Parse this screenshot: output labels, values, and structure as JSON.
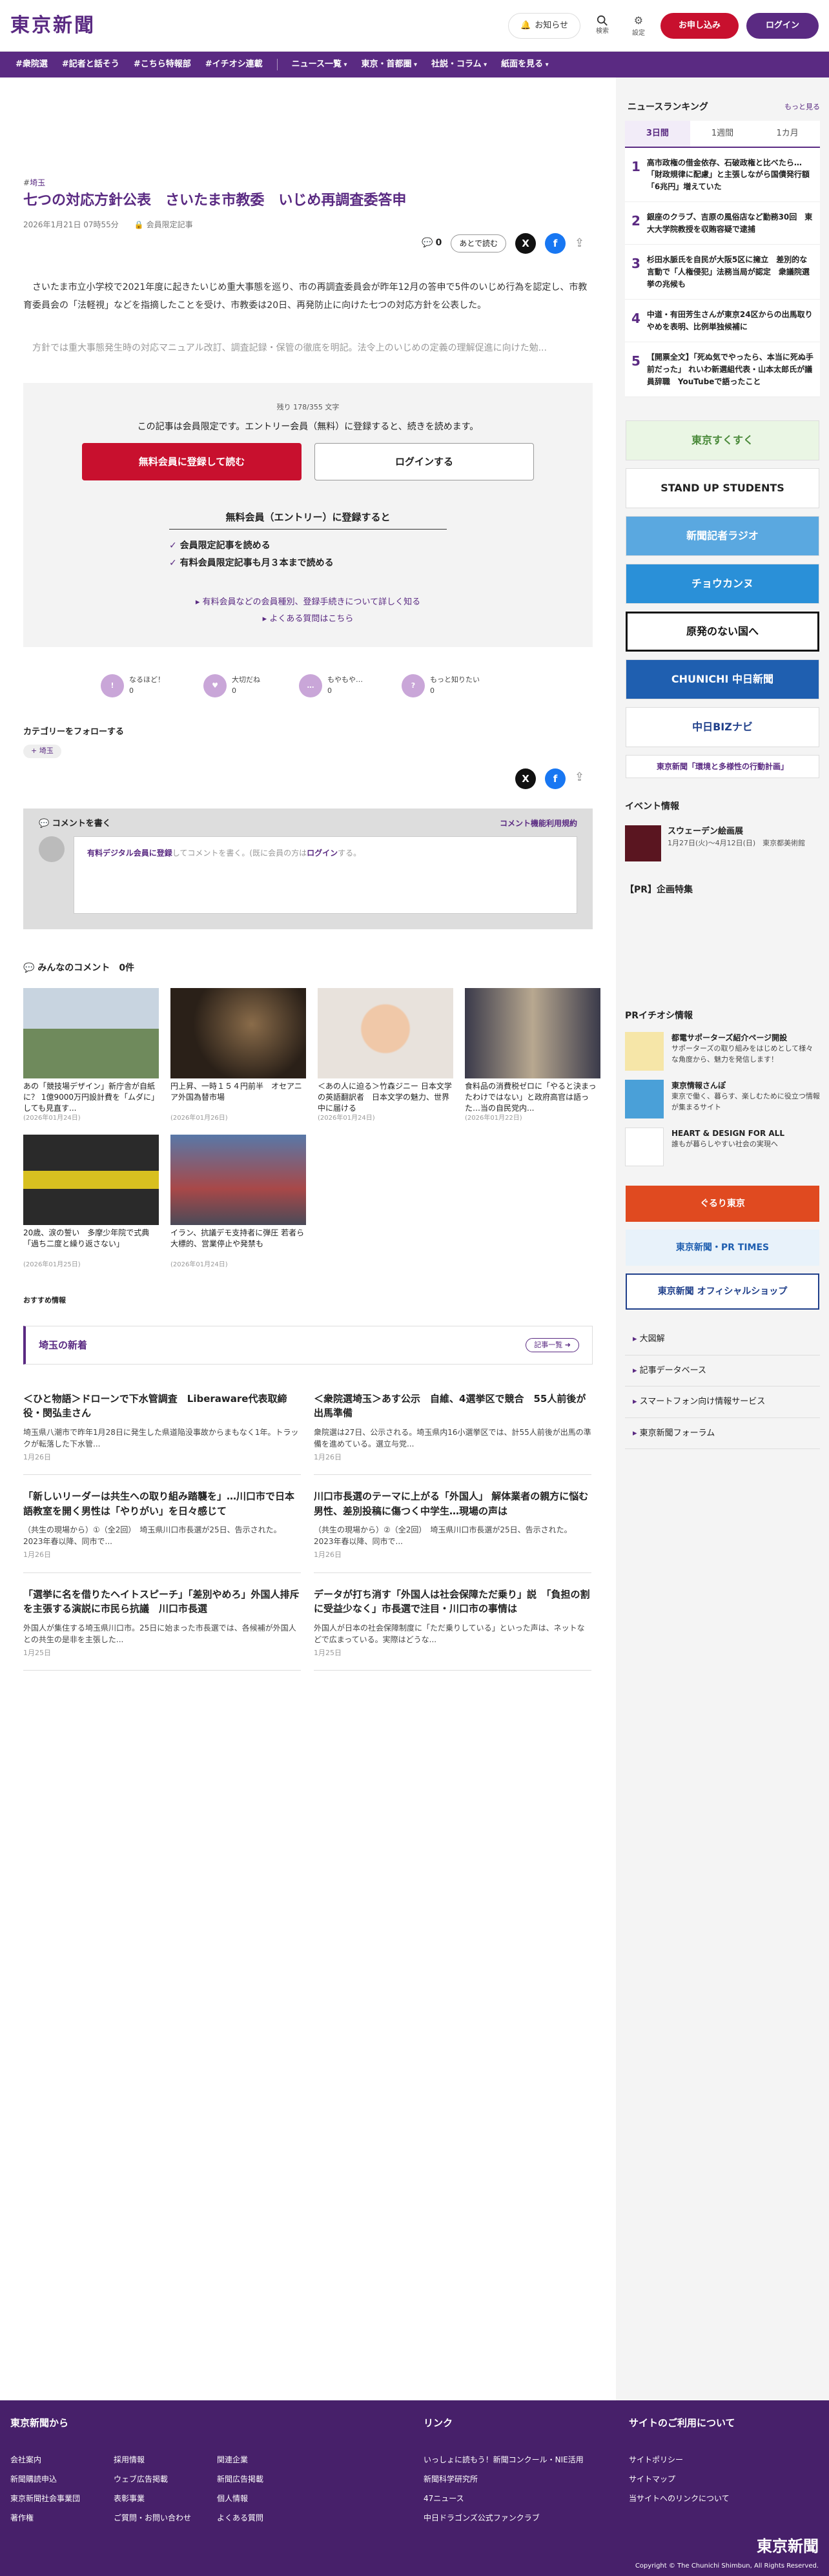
{
  "header": {
    "logo": "東京新聞",
    "notice": "お知らせ",
    "search": "検索",
    "settings": "設定",
    "register": "お申し込み",
    "login": "ログイン"
  },
  "nav": [
    "#衆院選",
    "#記者と話そう",
    "#こちら特報部",
    "#イチオシ連載",
    "ニュース一覧",
    "東京・首都圏",
    "社説・コラム",
    "紙面を見る"
  ],
  "article": {
    "tag": "埼玉",
    "title": "七つの対応方針公表　さいたま市教委　いじめ再調査委答申",
    "date": "2026年1月21日 07時55分",
    "members": "会員限定記事",
    "comment_count": "0",
    "later": "あとで読む",
    "p1": "さいたま市立小学校で2021年度に起きたいじめ重大事態を巡り、市の再調査委員会が昨年12月の答申で5件のいじめ行為を認定し、市教育委員会の「法軽視」などを指摘したことを受け、市教委は20日、再発防止に向けた七つの対応方針を公表した。",
    "p2": "方針では重大事態発生時の対応マニュアル改訂、調査記録・保管の徹底を明記。法令上のいじめの定義の理解促進に向けた勉..."
  },
  "paywall": {
    "remain": "残り 178/355 文字",
    "line": "この記事は会員限定です。エントリー会員（無料）に登録すると、続きを読めます。",
    "register": "無料会員に登録して読む",
    "login": "ログインする",
    "benefit_title": "無料会員（エントリー）に登録すると",
    "benefits": [
      "会員限定記事を読める",
      "有料会員限定記事も月３本まで読める"
    ],
    "link1": "有料会員などの会員種別、登録手続きについて詳しく知る",
    "link2": "よくある質問はこちら"
  },
  "reactions": [
    {
      "label": "なるほど！",
      "count": "0"
    },
    {
      "label": "大切だね",
      "count": "0"
    },
    {
      "label": "もやもや…",
      "count": "0"
    },
    {
      "label": "もっと知りたい",
      "count": "0"
    }
  ],
  "category": {
    "title": "カテゴリーをフォローする",
    "chip": "埼玉"
  },
  "comment": {
    "heading": "コメントを書く",
    "rules": "コメント機能利用規約",
    "placeholder_link": "有料デジタル会員に登録",
    "placeholder_rest": "してコメントを書く。(既に会員の方は",
    "placeholder_login": "ログイン",
    "placeholder_end": "する。",
    "all": "みんなのコメント",
    "all_count": "0件"
  },
  "photos": [
    {
      "title": "あの「競技場デザイン」新庁舎が自紙に？ 1億9000万円設計費を「ムダに」しても見直す...",
      "date": "(2026年01月24日)"
    },
    {
      "title": "円上昇、一時１５４円前半　オセアニア外国為替市場",
      "date": "(2026年01月26日)"
    },
    {
      "title": "＜あの人に迫る＞竹森ジニー 日本文学の英語翻訳者　日本文学の魅力、世界中に届ける",
      "date": "(2026年01月24日)"
    },
    {
      "title": "食料品の消費税ゼロに「やると決まったわけではない」と政府高官は語った…当の自民党内...",
      "date": "(2026年01月22日)"
    },
    {
      "title": "20歳、涙の誓い　多摩少年院で式典「過ち二度と繰り返さない」",
      "date": "(2026年01月25日)"
    },
    {
      "title": "イラン、抗議デモ支持者に弾圧 若者ら大標的、営業停止や発禁も",
      "date": "(2026年01月24日)"
    }
  ],
  "recommend": "おすすめ情報",
  "news_block": {
    "title": "埼玉の新着",
    "more": "記事一覧",
    "items": [
      {
        "title": "＜ひと物語＞ドローンで下水管調査　Liberaware代表取締役・閔弘圭さん",
        "body": "埼玉県八潮市で昨年1月28日に発生した県道陥没事故からまもなく1年。トラックが転落した下水管...",
        "date": "1月26日"
      },
      {
        "title": "＜衆院選埼玉＞あす公示　自維、4選挙区で競合　55人前後が出馬準備",
        "body": "衆院選は27日、公示される。埼玉県内16小選挙区では、計55人前後が出馬の準備を進めている。選立与党...",
        "date": "1月26日"
      },
      {
        "title": "「新しいリーダーは共生への取り組み踏襲を」…川口市で日本語教室を開く男性は「やりがい」を日々感じて",
        "body": "（共生の現場から）①（全2回）　埼玉県川口市長選が25日、告示された。2023年春以降、同市で...",
        "date": "1月26日"
      },
      {
        "title": "川口市長選のテーマに上がる「外国人」 解体業者の親方に悩む男性、差別投稿に傷つく中学生…現場の声は",
        "body": "（共生の現場から）②（全2回）　埼玉県川口市長選が25日、告示された。2023年春以降、同市で...",
        "date": "1月26日"
      },
      {
        "title": "「選挙に名を借りたヘイトスピーチ」「差別やめろ」外国人排斥を主張する演説に市民ら抗議　川口市長選",
        "body": "外国人が集住する埼玉県川口市。25日に始まった市長選では、各候補が外国人との共生の是非を主張した...",
        "date": "1月25日"
      },
      {
        "title": "データが打ち消す「外国人は社会保障ただ乗り」説　「負担の割に受益少なく」市長選で注目・川口市の事情は",
        "body": "外国人が日本の社会保障制度に「ただ乗りしている」といった声は、ネットなどで広まっている。実際はどうな...",
        "date": "1月25日"
      }
    ]
  },
  "ranking": {
    "title": "ニュースランキング",
    "more": "もっと見る",
    "tabs": [
      "3日間",
      "1週間",
      "1カ月"
    ],
    "items": [
      "高市政権の借金依存、石破政権と比べたら…「財政規律に配慮」と主張しながら国債発行額「6兆円」増えていた",
      "銀座のクラブ、吉原の風俗店など勤務30回　東大大学院教授を収賄容疑で逮捕",
      "杉田水脈氏を自民が大阪5区に擁立　差別的な言動で「人権侵犯」法務当局が認定　衆議院選挙の兆候も",
      "中道・有田芳生さんが東京24区からの出馬取りやめを表明、比例単独候補に",
      "【開票全文】「死ぬ気でやったら、本当に死ぬ手前だった」 れいわ新選組代表・山本太郎氏が議員辞職　YouTubeで語ったこと"
    ]
  },
  "banners": [
    "東京すくすく",
    "STAND UP STUDENTS",
    "新聞記者ラジオ",
    "チョウカンヌ",
    "原発のない国へ",
    "CHUNICHI 中日新聞",
    "中日BIZナビ",
    "東京新聞「環境と多様性の行動計画」"
  ],
  "event": {
    "title": "イベント情報",
    "name": "スウェーデン絵画展",
    "desc": "1月27日(火)〜4月12日(日)　東京都美術館"
  },
  "pr_title": "【PR】企画特集",
  "pr_osusume": "PRイチオシ情報",
  "pr": [
    {
      "name": "都電サポーターズ紹介ページ開設",
      "desc": "サポーターズの取り組みをはじめとして様々な角度から、魅力を発信します！"
    },
    {
      "name": "東京情報さんぽ",
      "desc": "東京で働く、暮らす、楽しむために役立つ情報が集まるサイト"
    },
    {
      "name": "HEART & DESIGN FOR ALL",
      "desc": "誰もが暮らしやすい社会の実現へ"
    }
  ],
  "side_banners": [
    "ぐるり東京",
    "東京新聞・PR TIMES",
    "東京新聞 オフィシャルショップ"
  ],
  "side_links": [
    "大図解",
    "記事データベース",
    "スマートフォン向け情報サービス",
    "東京新聞フォーラム"
  ],
  "footer": {
    "col1_title": "東京新聞から",
    "col1": [
      "会社案内",
      "採用情報",
      "関連企業",
      "新聞購読申込",
      "ウェブ広告掲載",
      "新聞広告掲載",
      "東京新聞社会事業団",
      "表彰事業",
      "個人情報",
      "著作権",
      "ご質問・お問い合わせ",
      "よくある質問"
    ],
    "col2_title": "リンク",
    "col2": [
      "いっしょに読もう！新聞コンクール・NIE活用",
      "新聞科学研究所",
      "47ニュース",
      "中日ドラゴンズ公式ファンクラブ"
    ],
    "col3_title": "サイトのご利用について",
    "col3": [
      "サイトポリシー",
      "サイトマップ",
      "当サイトへのリンクについて"
    ],
    "logo": "東京新聞",
    "copy": "Copyright © The Chunichi Shimbun, All Rights Reserved."
  }
}
